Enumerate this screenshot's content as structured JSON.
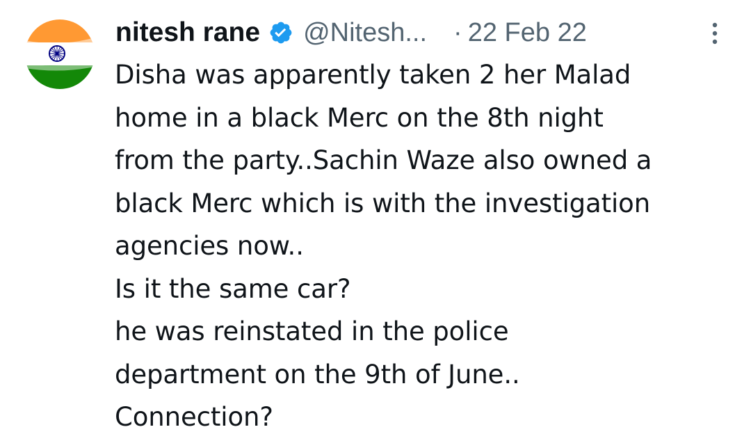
{
  "tweet": {
    "author": {
      "display_name": "nitesh rane",
      "handle": "@Nitesh...",
      "verified_icon": "verified-badge-icon",
      "avatar": "indian-flag-avatar"
    },
    "separator": "·",
    "date": "22 Feb 22",
    "more_icon": "more-vertical-icon",
    "text_lines": [
      "Disha was apparently taken 2 her Malad",
      "home in a black Merc on the 8th night",
      "from the party..Sachin Waze also owned a",
      "black Merc which is with the investigation",
      "agencies now..",
      "Is it the same car?",
      "he was reinstated in the police",
      "department on the 9th of June..",
      "Connection?"
    ]
  },
  "colors": {
    "text_primary": "#0f1419",
    "text_secondary": "#536471",
    "verified_blue": "#1d9bf0",
    "flag_saffron": "#ff9933",
    "flag_white": "#ffffff",
    "flag_green": "#138808",
    "chakra_navy": "#000080"
  }
}
